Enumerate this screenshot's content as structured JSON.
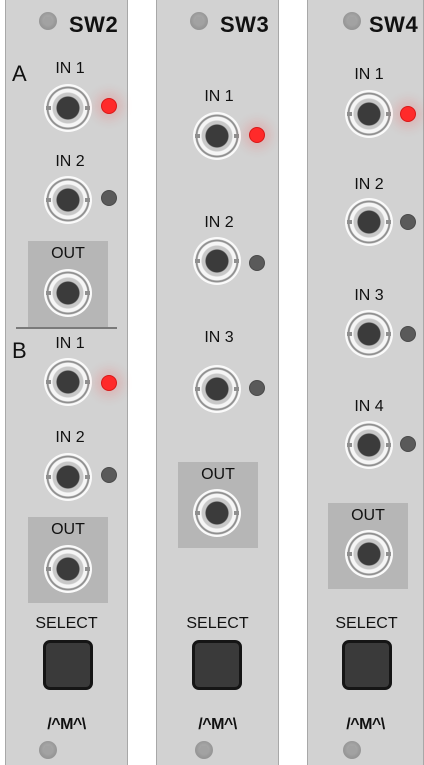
{
  "modules": [
    {
      "title": "SW2",
      "section_a": "A",
      "section_b": "B",
      "inputs_a": [
        {
          "label": "IN 1",
          "active": true
        },
        {
          "label": "IN 2",
          "active": false
        }
      ],
      "inputs_b": [
        {
          "label": "IN 1",
          "active": true
        },
        {
          "label": "IN 2",
          "active": false
        }
      ],
      "out_label": "OUT",
      "out_label_b": "OUT",
      "select_label": "SELECT",
      "logo": "/^M^\\"
    },
    {
      "title": "SW3",
      "inputs": [
        {
          "label": "IN 1",
          "active": true
        },
        {
          "label": "IN 2",
          "active": false
        },
        {
          "label": "IN 3",
          "active": false
        }
      ],
      "out_label": "OUT",
      "select_label": "SELECT",
      "logo": "/^M^\\"
    },
    {
      "title": "SW4",
      "inputs": [
        {
          "label": "IN 1",
          "active": true
        },
        {
          "label": "IN 2",
          "active": false
        },
        {
          "label": "IN 3",
          "active": false
        },
        {
          "label": "IN 4",
          "active": false
        }
      ],
      "out_label": "OUT",
      "select_label": "SELECT",
      "logo": "/^M^\\"
    }
  ],
  "colors": {
    "led_on": "#ff2a2a",
    "led_off": "#5a5a5a",
    "panel": "#d2d2d2"
  }
}
